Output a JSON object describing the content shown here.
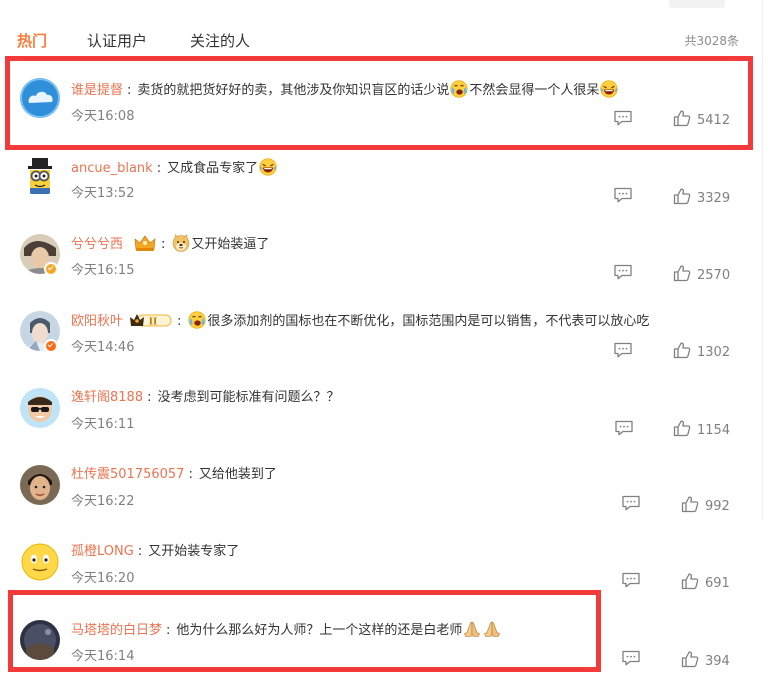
{
  "tabs": [
    {
      "label": "热门",
      "active": true
    },
    {
      "label": "认证用户",
      "active": false
    },
    {
      "label": "关注的人",
      "active": false
    }
  ],
  "total_label": "共3028条",
  "comments": [
    {
      "user": "谁是提督",
      "text_parts": [
        "卖货的就把货好好的卖，其他涉及你知识盲区的话少说",
        "不然会显得一个人很呆"
      ],
      "emojis": [
        "tear-laugh-emoji",
        "laugh-emoji"
      ],
      "time": "今天16:08",
      "likes": "5412",
      "highlighted": true
    },
    {
      "user": "ancue_blank",
      "text_parts": [
        "又成食品专家了"
      ],
      "emojis": [
        "laugh-emoji"
      ],
      "time": "今天13:52",
      "likes": "3329",
      "highlighted": false
    },
    {
      "user": "兮兮兮西",
      "text_parts": [
        "又开始装逼了"
      ],
      "emojis": [
        "doge-emoji"
      ],
      "time": "今天16:15",
      "likes": "2570",
      "highlighted": false,
      "badge": "crown-badge"
    },
    {
      "user": "欧阳秋叶",
      "text_parts": [
        "很多添加剂的国标也在不断优化，国标范围内是可以销售，不代表可以放心吃"
      ],
      "emojis": [
        "tear-laugh-emoji"
      ],
      "time": "今天14:46",
      "likes": "1302",
      "highlighted": false,
      "badge": "vip-level-badge",
      "vip_level": "II"
    },
    {
      "user": "逸轩阁8188",
      "text_parts": [
        "没考虑到可能标准有问题么？？"
      ],
      "emojis": [],
      "time": "今天16:11",
      "likes": "1154",
      "highlighted": false
    },
    {
      "user": "杜传震501756057",
      "text_parts": [
        "又给他装到了"
      ],
      "emojis": [],
      "time": "今天16:22",
      "likes": "992",
      "highlighted": false
    },
    {
      "user": "孤橙LONG",
      "text_parts": [
        "又开始装专家了"
      ],
      "emojis": [],
      "time": "今天16:20",
      "likes": "691",
      "highlighted": false
    },
    {
      "user": "马塔塔的白日梦",
      "text_parts": [
        "他为什么那么好为人师？上一个这样的还是白老师"
      ],
      "emojis": [
        "pray-emoji",
        "pray-emoji"
      ],
      "time": "今天16:14",
      "likes": "394",
      "highlighted": true
    }
  ],
  "colors": {
    "accent": "#fa7d3c",
    "username": "#eb7350",
    "highlight": "#f23a3a",
    "meta": "#808080"
  }
}
